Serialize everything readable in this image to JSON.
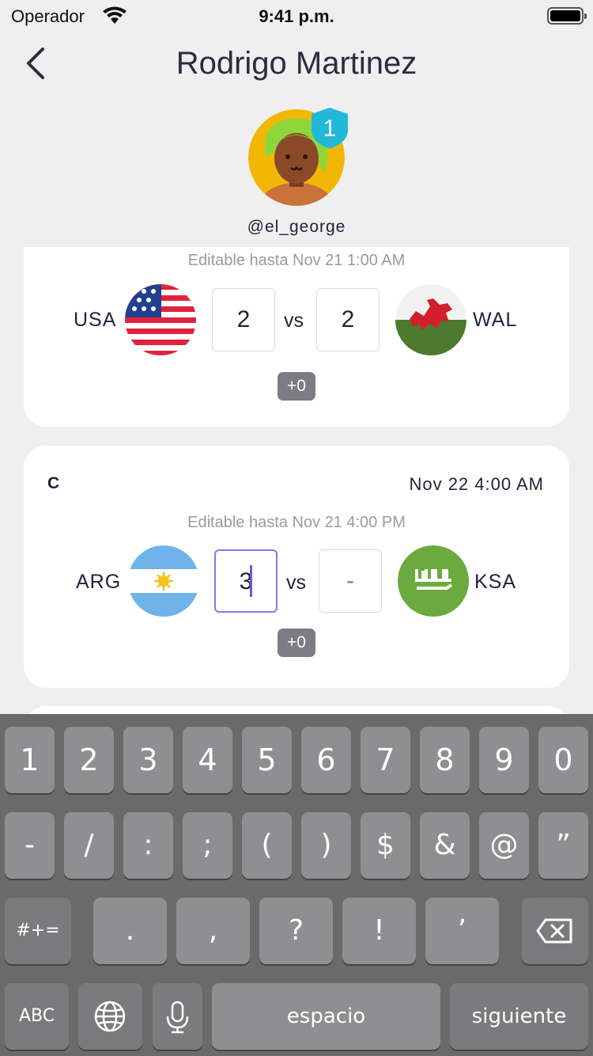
{
  "status_bar": {
    "carrier": "Operador",
    "time": "9:41 p.m."
  },
  "nav": {
    "title": "Rodrigo Martinez"
  },
  "profile": {
    "username": "@el_george",
    "rank": "1"
  },
  "matches": [
    {
      "group": "",
      "date": "",
      "editable": "Editable hasta Nov 21 1:00 AM",
      "home": {
        "code": "USA",
        "score": "2"
      },
      "vs": "vs",
      "away": {
        "code": "WAL",
        "score": "2"
      },
      "points": "+0"
    },
    {
      "group": "C",
      "date": "Nov 22 4:00 AM",
      "editable": "Editable hasta Nov 21 4:00 PM",
      "home": {
        "code": "ARG",
        "score": "3"
      },
      "vs": "vs",
      "away": {
        "code": "KSA",
        "score": "-"
      },
      "points": "+0"
    }
  ],
  "keyboard": {
    "row1": [
      "1",
      "2",
      "3",
      "4",
      "5",
      "6",
      "7",
      "8",
      "9",
      "0"
    ],
    "row2": [
      "-",
      "/",
      ":",
      ";",
      "(",
      ")",
      "$",
      "&",
      "@",
      "”"
    ],
    "row3": [
      "#+=",
      ".",
      ",",
      "?",
      "!",
      "’"
    ],
    "row4": {
      "abc": "ABC",
      "space": "espacio",
      "next": "siguiente"
    }
  }
}
